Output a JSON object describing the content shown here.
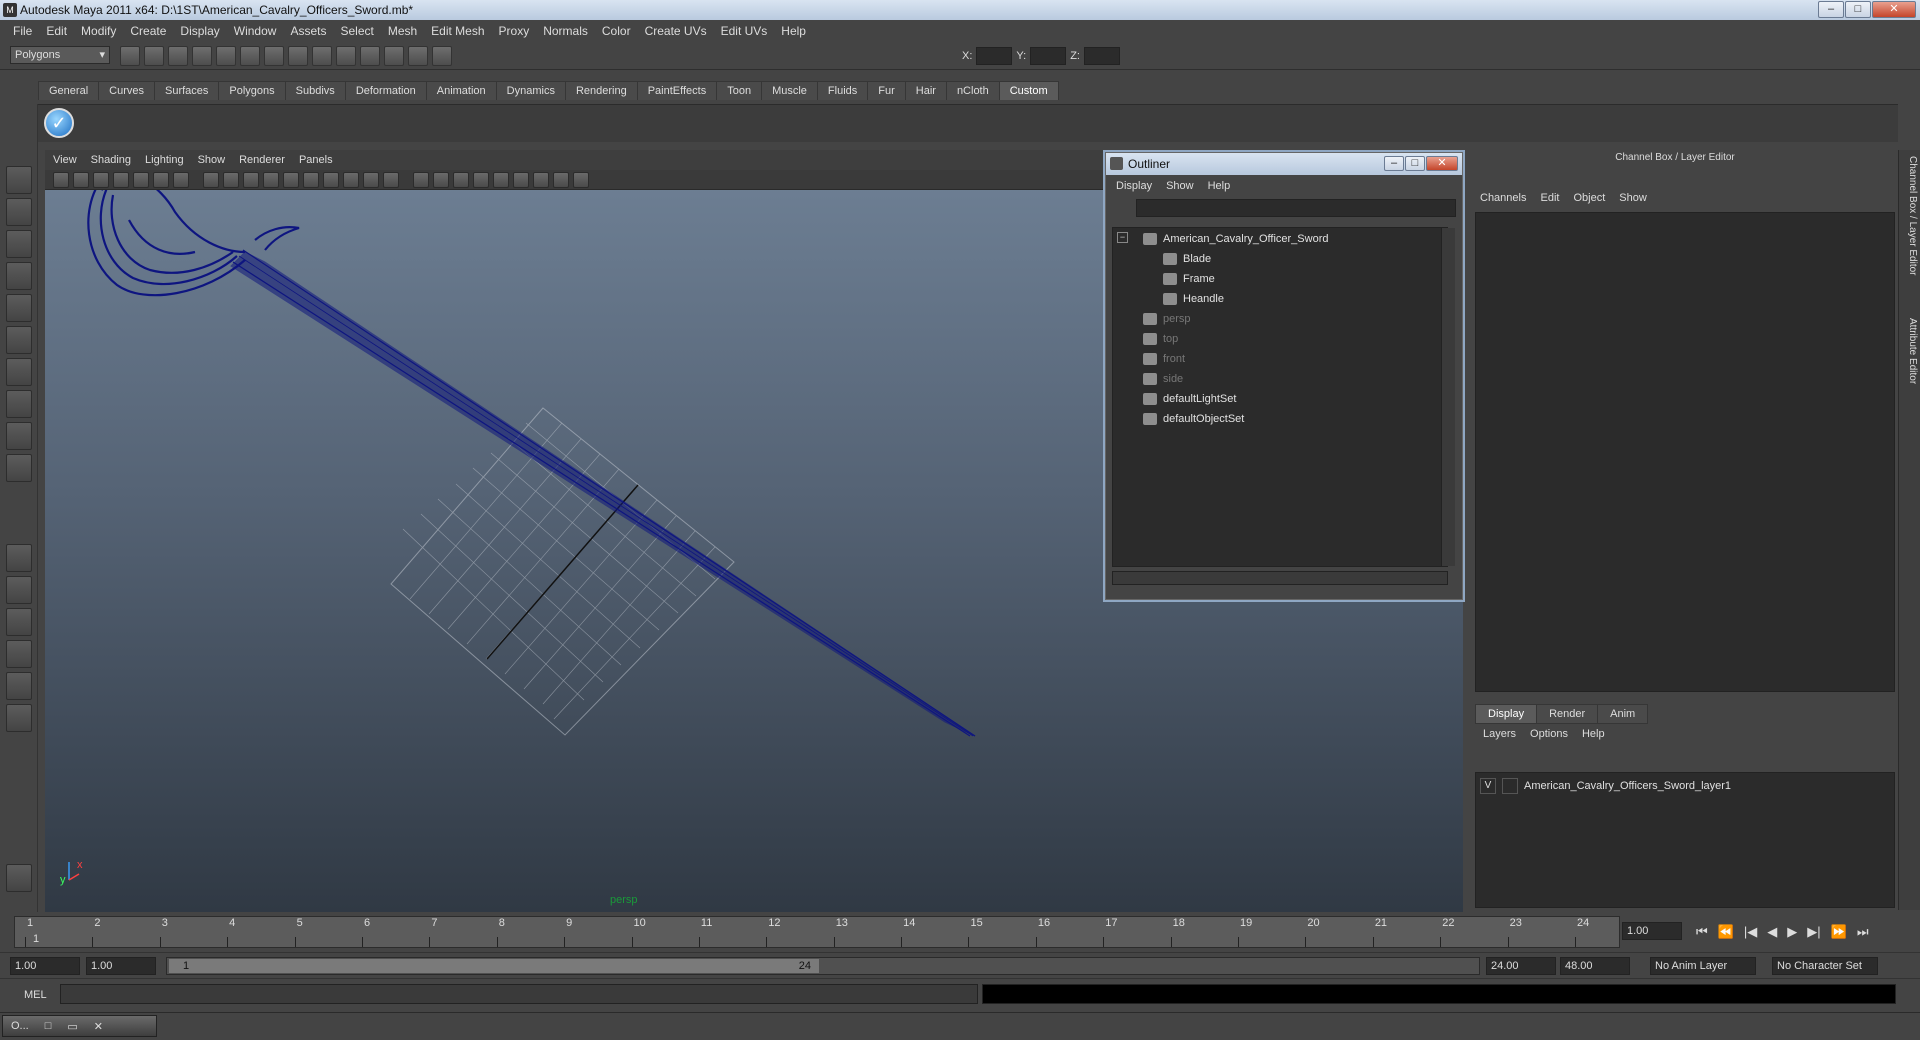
{
  "window": {
    "title": "Autodesk Maya 2011 x64: D:\\1ST\\American_Cavalry_Officers_Sword.mb*"
  },
  "menubar": [
    "File",
    "Edit",
    "Modify",
    "Create",
    "Display",
    "Window",
    "Assets",
    "Select",
    "Mesh",
    "Edit Mesh",
    "Proxy",
    "Normals",
    "Color",
    "Create UVs",
    "Edit UVs",
    "Help"
  ],
  "statusline": {
    "mode": "Polygons",
    "x_label": "X:",
    "y_label": "Y:",
    "z_label": "Z:"
  },
  "shelf": {
    "tabs": [
      "General",
      "Curves",
      "Surfaces",
      "Polygons",
      "Subdivs",
      "Deformation",
      "Animation",
      "Dynamics",
      "Rendering",
      "PaintEffects",
      "Toon",
      "Muscle",
      "Fluids",
      "Fur",
      "Hair",
      "nCloth",
      "Custom"
    ],
    "active_tab": "Custom"
  },
  "viewport": {
    "menu": [
      "View",
      "Shading",
      "Lighting",
      "Show",
      "Renderer",
      "Panels"
    ],
    "camera_label": "persp",
    "axis_x": "x",
    "axis_y": "y"
  },
  "outliner": {
    "title": "Outliner",
    "menu": [
      "Display",
      "Show",
      "Help"
    ],
    "items": [
      {
        "label": "American_Cavalry_Officer_Sword",
        "style": "bright"
      },
      {
        "label": "Blade",
        "style": "bright"
      },
      {
        "label": "Frame",
        "style": "bright"
      },
      {
        "label": "Heandle",
        "style": "bright"
      },
      {
        "label": "persp",
        "style": "dim"
      },
      {
        "label": "top",
        "style": "dim"
      },
      {
        "label": "front",
        "style": "dim"
      },
      {
        "label": "side",
        "style": "dim"
      },
      {
        "label": "defaultLightSet",
        "style": "bright"
      },
      {
        "label": "defaultObjectSet",
        "style": "bright"
      }
    ]
  },
  "channelbox": {
    "title": "Channel Box / Layer Editor",
    "menu": [
      "Channels",
      "Edit",
      "Object",
      "Show"
    ],
    "layer_tabs": [
      "Display",
      "Render",
      "Anim"
    ],
    "active_layer_tab": "Display",
    "layer_menu": [
      "Layers",
      "Options",
      "Help"
    ],
    "layer": {
      "visibility": "V",
      "name": "American_Cavalry_Officers_Sword_layer1"
    }
  },
  "sidetabs": {
    "channel": "Channel Box / Layer Editor",
    "attribute": "Attribute Editor"
  },
  "timeslider": {
    "ticks": [
      "1",
      "2",
      "3",
      "4",
      "5",
      "6",
      "7",
      "8",
      "9",
      "10",
      "11",
      "12",
      "13",
      "14",
      "15",
      "16",
      "17",
      "18",
      "19",
      "20",
      "21",
      "22",
      "23",
      "24"
    ],
    "current_marker": "1",
    "current_frame": "1.00",
    "playback": [
      "⏮",
      "⏪",
      "|◀",
      "◀",
      "▶",
      "▶|",
      "⏩",
      "⏭"
    ]
  },
  "rangeslider": {
    "start": "1.00",
    "playback_start": "1.00",
    "handle_start": "1",
    "handle_end": "24",
    "playback_end": "24.00",
    "end": "48.00",
    "anim_layer": "No Anim Layer",
    "character_set": "No Character Set"
  },
  "cmdline": {
    "label": "MEL"
  },
  "taskbar": {
    "item": "O..."
  }
}
